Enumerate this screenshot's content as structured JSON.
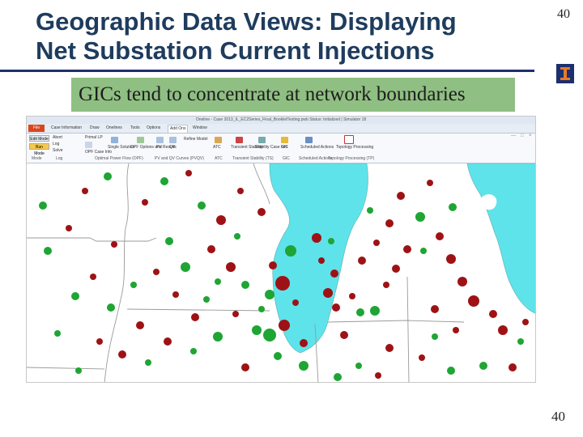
{
  "slide": {
    "title_lines": [
      "Geographic Data Views: Displaying",
      "Net Substation Current Injections"
    ],
    "slide_number_top": "40",
    "slide_number_bottom": "40",
    "callout": "GICs tend to concentrate at network boundaries",
    "colors": {
      "title": "#1e3c5e",
      "rule": "#1c2f6e",
      "callout_bg": "#8fbf82",
      "logo_bg": "#1c2f6e",
      "logo_fg": "#e8792a"
    }
  },
  "app": {
    "window_title": "Oneline - Case 2013_IL_EC2Series_Final_BookletTesting.pwb Status: Initialized | Simulator 18",
    "ribbon_tabs": [
      "File",
      "Case Information",
      "Draw",
      "Onelines",
      "Tools",
      "Options",
      "Add Ons",
      "Window"
    ],
    "active_tab": "Add Ons",
    "mode_buttons": {
      "edit": "Edit Mode",
      "run": "Run Mode"
    },
    "ribbon_small_buttons": [
      "Abort",
      "Log",
      "Solve",
      "Primal LP",
      "OPF Case Info",
      "Single Solution",
      "OPF Options and Results",
      "PV",
      "QV",
      "Refine Model",
      "ATC",
      "Transient Stability",
      "Stability Case Info",
      "GIC",
      "Scheduled Actions",
      "Topology Processing"
    ],
    "ribbon_group_labels": [
      "Mode",
      "Log",
      "Optimal Power Flow (OPF)",
      "PV and QV Curves (PVQV)",
      "ATC",
      "Transient Stability (TS)",
      "GIC",
      "Scheduled Actions",
      "Topology Processing (TP)"
    ],
    "map_colors": {
      "lake": "#5ee3ea",
      "border": "#9a9a9a",
      "positive": "#1ea534",
      "negative": "#9e1216"
    }
  }
}
